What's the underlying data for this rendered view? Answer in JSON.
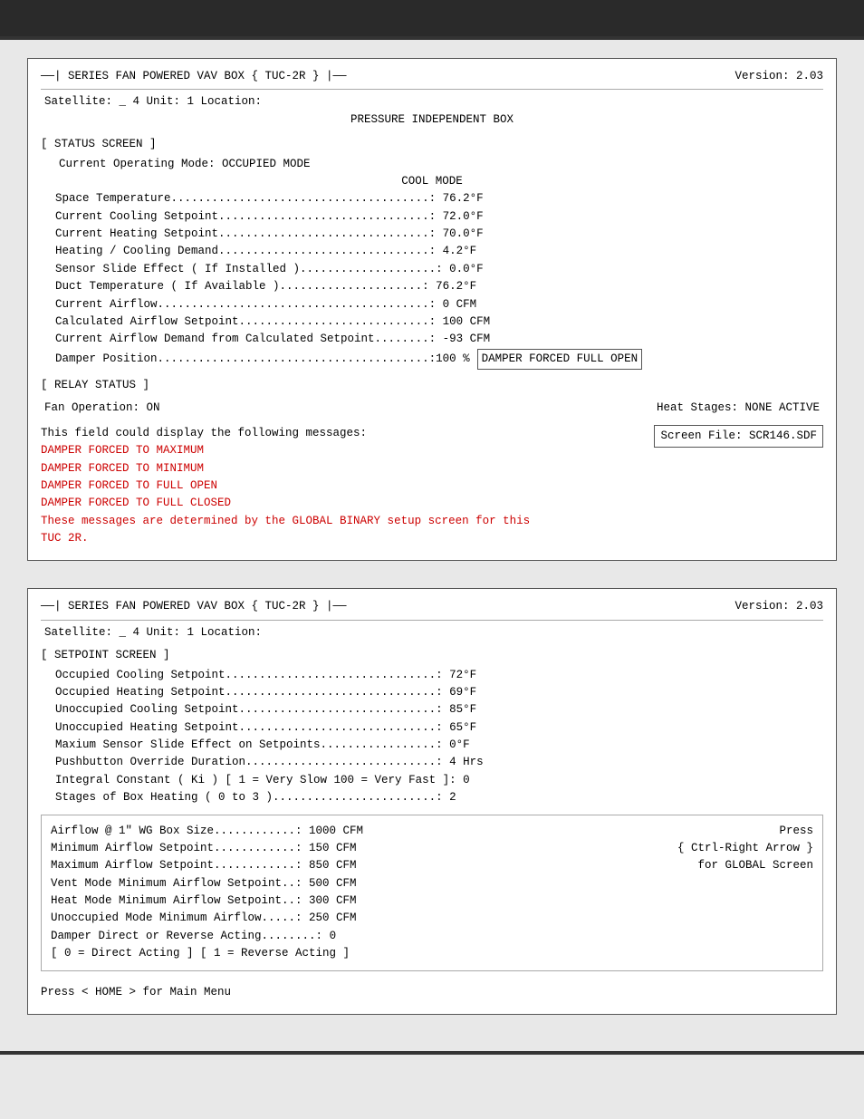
{
  "topBar": {
    "title": ""
  },
  "screen1": {
    "headerLeft": "——| SERIES FAN POWERED VAV BOX   { TUC-2R } |——",
    "satelliteInfo": "Satellite:  _ 4   Unit:  1   Location:",
    "version": "Version: 2.03",
    "subtitle": "PRESSURE INDEPENDENT BOX",
    "statusLabel": "[ STATUS SCREEN ]",
    "currentMode1": "Current Operating Mode: OCCUPIED MODE",
    "currentMode2": "COOL MODE",
    "dataRows": [
      {
        "label": "Space Temperature......................................",
        "value": "76.2°F"
      },
      {
        "label": "Current Cooling Setpoint...............................",
        "value": "72.0°F"
      },
      {
        "label": "Current Heating Setpoint...............................",
        "value": "70.0°F"
      },
      {
        "label": "Heating / Cooling Demand...............................",
        "value": "4.2°F"
      },
      {
        "label": "Sensor Slide Effect ( If Installed )....................",
        "value": "0.0°F"
      },
      {
        "label": "Duct Temperature   ( If Available ).....................",
        "value": "76.2°F"
      },
      {
        "label": "Current Airflow........................................",
        "value": "0 CFM"
      },
      {
        "label": "Calculated Airflow Setpoint............................",
        "value": "100 CFM"
      },
      {
        "label": "Current Airflow Demand from Calculated Setpoint........",
        "value": "-93 CFM"
      },
      {
        "label": "Damper Position........................................",
        "value": "100 %"
      }
    ],
    "damperForced": "DAMPER FORCED FULL OPEN",
    "relayLabel": "[ RELAY STATUS ]",
    "fanOp": "Fan Operation: ON",
    "heatStages": "Heat Stages: NONE ACTIVE",
    "fieldMsg": "This field could display the following messages:",
    "screenFile": "Screen File: SCR146.SDF",
    "redMessages": [
      "DAMPER FORCED TO MAXIMUM",
      "DAMPER FORCED TO MINIMUM",
      "DAMPER FORCED TO FULL OPEN",
      "DAMPER FORCED TO FULL CLOSED"
    ],
    "globalNote": "These messages are determined by the GLOBAL BINARY setup screen for this TUC 2R."
  },
  "screen2": {
    "headerLeft": "——| SERIES FAN POWERED VAV BOX   { TUC-2R } |——",
    "satelliteInfo": "Satellite:  _ 4   Unit:  1   Location:",
    "version": "Version: 2.03",
    "setpointLabel": "[ SETPOINT SCREEN ]",
    "setpointRows": [
      {
        "label": "Occupied Cooling Setpoint...............................",
        "value": "72°F"
      },
      {
        "label": "Occupied Heating Setpoint...............................",
        "value": "69°F"
      },
      {
        "label": "Unoccupied Cooling Setpoint.............................",
        "value": "85°F"
      },
      {
        "label": "Unoccupied Heating Setpoint.............................",
        "value": "65°F"
      },
      {
        "label": "Maxium Sensor Slide Effect on Setpoints.................",
        "value": "0°F"
      },
      {
        "label": "Pushbutton Override Duration............................",
        "value": "4 Hrs"
      },
      {
        "label": "Integral Constant ( Ki )  [ 1 = Very Slow   100 = Very Fast ]:",
        "value": "0"
      },
      {
        "label": "Stages of Box Heating ( 0 to 3 )........................",
        "value": "2"
      }
    ],
    "airflowRows": [
      {
        "label": "Airflow @ 1\" WG Box Size............:",
        "value": "1000 CFM"
      },
      {
        "label": "Minimum Airflow Setpoint............:",
        "value": "150 CFM"
      },
      {
        "label": "Maximum Airflow Setpoint............:",
        "value": "850 CFM"
      },
      {
        "label": "Vent Mode Minimum Airflow Setpoint..:",
        "value": "500 CFM"
      },
      {
        "label": "Heat Mode Minimum Airflow Setpoint..:",
        "value": "300 CFM"
      },
      {
        "label": "Unoccupied Mode Minimum Airflow....:",
        "value": "250 CFM"
      },
      {
        "label": "Damper Direct or Reverse Acting........:",
        "value": "0"
      }
    ],
    "actingNote": "[ 0 = Direct Acting ] [ 1 = Reverse Acting ]",
    "pressRight": "Press",
    "ctrlArrow": "{ Ctrl-Right Arrow }",
    "forGlobal": "for GLOBAL Screen",
    "pressHome": "Press < HOME > for Main Menu"
  }
}
